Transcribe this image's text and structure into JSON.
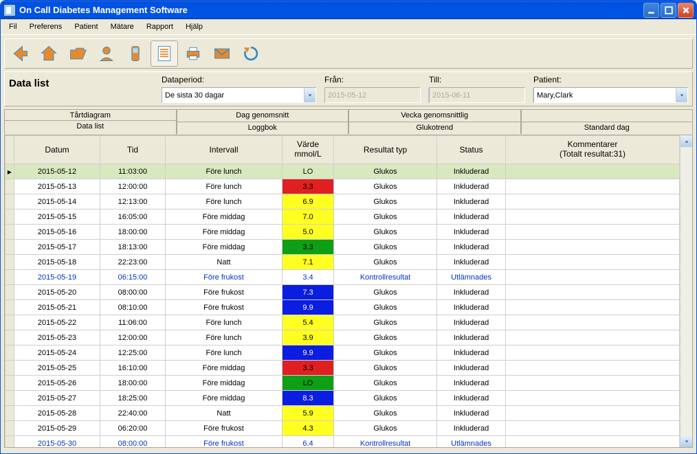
{
  "window": {
    "title": "On Call Diabetes Management Software"
  },
  "menu": [
    "Fil",
    "Preferens",
    "Patient",
    "Mätare",
    "Rapport",
    "Hjälp"
  ],
  "page_title": "Data list",
  "filters": {
    "period_label": "Dataperiod:",
    "period_value": "De sista 30 dagar",
    "from_label": "Från:",
    "from_value": "2015-05-12",
    "to_label": "Till:",
    "to_value": "2015-06-11",
    "patient_label": "Patient:",
    "patient_value": "Mary,Clark"
  },
  "tabs_top": [
    "Tårtdiagram",
    "Dag genomsnitt",
    "Vecka genomsnittlig",
    ""
  ],
  "tabs_bot": [
    "Data list",
    "Loggbok",
    "Glukotrend",
    "Standard dag"
  ],
  "columns": {
    "date": "Datum",
    "time": "Tid",
    "interval": "Intervall",
    "value": "Värde\nmmol/L",
    "type": "Resultat typ",
    "status": "Status",
    "comment": "Kommentarer\n(Totalt resultat:31)"
  },
  "rows": [
    {
      "date": "2015-05-12",
      "time": "11:03:00",
      "interval": "Före lunch",
      "value": "LO",
      "vclass": "val-green",
      "type": "Glukos",
      "status": "Inkluderad",
      "sel": true
    },
    {
      "date": "2015-05-13",
      "time": "12:00:00",
      "interval": "Före lunch",
      "value": "3.3",
      "vclass": "val-red",
      "type": "Glukos",
      "status": "Inkluderad"
    },
    {
      "date": "2015-05-14",
      "time": "12:13:00",
      "interval": "Före lunch",
      "value": "6.9",
      "vclass": "val-yellow",
      "type": "Glukos",
      "status": "Inkluderad"
    },
    {
      "date": "2015-05-15",
      "time": "16:05:00",
      "interval": "Före middag",
      "value": "7.0",
      "vclass": "val-yellow",
      "type": "Glukos",
      "status": "Inkluderad"
    },
    {
      "date": "2015-05-16",
      "time": "18:00:00",
      "interval": "Före middag",
      "value": "5.0",
      "vclass": "val-yellow",
      "type": "Glukos",
      "status": "Inkluderad"
    },
    {
      "date": "2015-05-17",
      "time": "18:13:00",
      "interval": "Före middag",
      "value": "3.3",
      "vclass": "val-green",
      "type": "Glukos",
      "status": "Inkluderad"
    },
    {
      "date": "2015-05-18",
      "time": "22:23:00",
      "interval": "Natt",
      "value": "7.1",
      "vclass": "val-yellow",
      "type": "Glukos",
      "status": "Inkluderad"
    },
    {
      "date": "2015-05-19",
      "time": "06:15:00",
      "interval": "Före frukost",
      "value": "3.4",
      "vclass": "",
      "type": "Kontrollresultat",
      "status": "Utlämnades",
      "blue": true
    },
    {
      "date": "2015-05-20",
      "time": "08:00:00",
      "interval": "Före frukost",
      "value": "7.3",
      "vclass": "val-blue",
      "type": "Glukos",
      "status": "Inkluderad"
    },
    {
      "date": "2015-05-21",
      "time": "08:10:00",
      "interval": "Före frukost",
      "value": "9.9",
      "vclass": "val-blue",
      "type": "Glukos",
      "status": "Inkluderad"
    },
    {
      "date": "2015-05-22",
      "time": "11:06:00",
      "interval": "Före lunch",
      "value": "5.4",
      "vclass": "val-yellow",
      "type": "Glukos",
      "status": "Inkluderad"
    },
    {
      "date": "2015-05-23",
      "time": "12:00:00",
      "interval": "Före lunch",
      "value": "3.9",
      "vclass": "val-yellow",
      "type": "Glukos",
      "status": "Inkluderad"
    },
    {
      "date": "2015-05-24",
      "time": "12:25:00",
      "interval": "Före lunch",
      "value": "9.9",
      "vclass": "val-blue",
      "type": "Glukos",
      "status": "Inkluderad"
    },
    {
      "date": "2015-05-25",
      "time": "16:10:00",
      "interval": "Före middag",
      "value": "3.3",
      "vclass": "val-red",
      "type": "Glukos",
      "status": "Inkluderad"
    },
    {
      "date": "2015-05-26",
      "time": "18:00:00",
      "interval": "Före middag",
      "value": "LO",
      "vclass": "val-green",
      "type": "Glukos",
      "status": "Inkluderad"
    },
    {
      "date": "2015-05-27",
      "time": "18:25:00",
      "interval": "Före middag",
      "value": "8.3",
      "vclass": "val-blue",
      "type": "Glukos",
      "status": "Inkluderad"
    },
    {
      "date": "2015-05-28",
      "time": "22:40:00",
      "interval": "Natt",
      "value": "5.9",
      "vclass": "val-yellow",
      "type": "Glukos",
      "status": "Inkluderad"
    },
    {
      "date": "2015-05-29",
      "time": "06:20:00",
      "interval": "Före frukost",
      "value": "4.3",
      "vclass": "val-yellow",
      "type": "Glukos",
      "status": "Inkluderad"
    },
    {
      "date": "2015-05-30",
      "time": "08:00:00",
      "interval": "Före frukost",
      "value": "6.4",
      "vclass": "",
      "type": "Kontrollresultat",
      "status": "Utlämnades",
      "blue": true
    }
  ],
  "colors": {
    "orange": "#E68A2E",
    "blue": "#2E8AC8"
  }
}
